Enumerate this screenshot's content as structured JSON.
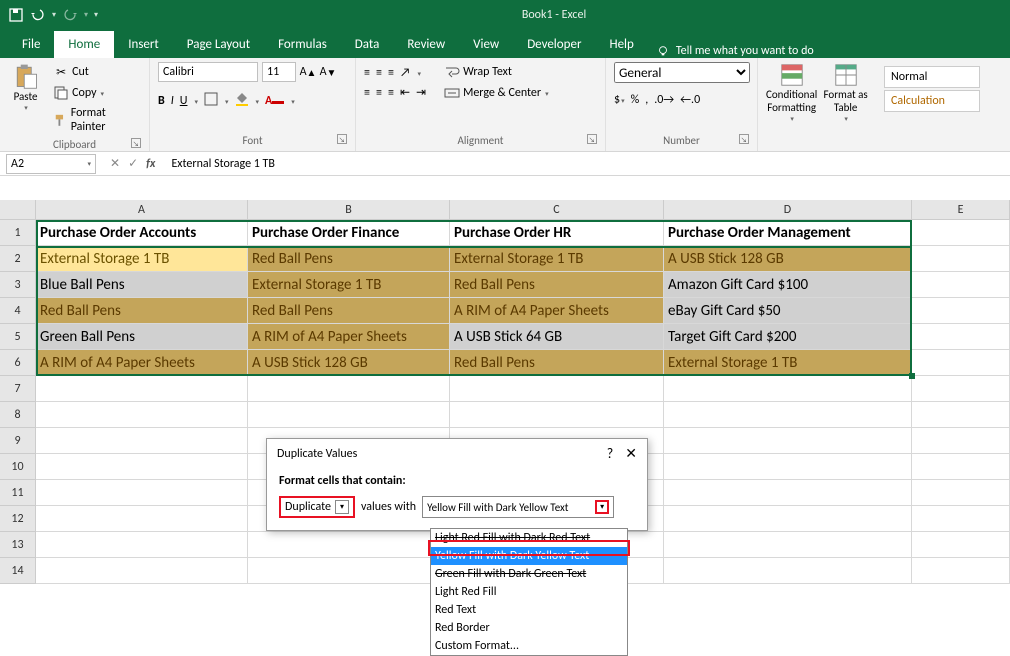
{
  "title": "Book1 - Excel",
  "menus": {
    "file": "File",
    "home": "Home",
    "insert": "Insert",
    "pageLayout": "Page Layout",
    "formulas": "Formulas",
    "data": "Data",
    "review": "Review",
    "view": "View",
    "developer": "Developer",
    "help": "Help",
    "tellMe": "Tell me what you want to do"
  },
  "ribbon": {
    "clipboard": {
      "paste": "Paste",
      "cut": "Cut",
      "copy": "Copy",
      "formatPainter": "Format Painter",
      "label": "Clipboard"
    },
    "font": {
      "name": "Calibri",
      "size": "11",
      "label": "Font"
    },
    "alignment": {
      "wrap": "Wrap Text",
      "merge": "Merge & Center",
      "label": "Alignment"
    },
    "number": {
      "format": "General",
      "label": "Number"
    },
    "styles": {
      "cond": "Conditional Formatting",
      "table": "Format as Table",
      "normal": "Normal",
      "calc": "Calculation"
    }
  },
  "nameBox": "A2",
  "formula": "External Storage 1 TB",
  "cols": [
    "A",
    "B",
    "C",
    "D",
    "E"
  ],
  "headers": {
    "A": "Purchase Order Accounts",
    "B": "Purchase Order Finance",
    "C": "Purchase Order HR",
    "D": "Purchase Order Management"
  },
  "rows": [
    {
      "A": "External Storage 1 TB",
      "B": "Red Ball Pens",
      "C": "External Storage 1 TB",
      "D": "A USB Stick 128 GB"
    },
    {
      "A": "Blue Ball Pens",
      "B": "External Storage 1 TB",
      "C": "Red Ball Pens",
      "D": "Amazon Gift Card $100"
    },
    {
      "A": "Red Ball Pens",
      "B": "Red Ball Pens",
      "C": "A RIM of A4 Paper Sheets",
      "D": "eBay Gift Card $50"
    },
    {
      "A": "Green Ball Pens",
      "B": "A RIM of A4 Paper Sheets",
      "C": "A USB Stick 64 GB",
      "D": "Target Gift Card $200"
    },
    {
      "A": "A RIM of A4 Paper Sheets",
      "B": "A USB Stick 128 GB",
      "C": "Red Ball Pens",
      "D": "External Storage 1 TB"
    }
  ],
  "dupCells": [
    "A2",
    "B2",
    "C2",
    "D2",
    "B3",
    "C3",
    "A4",
    "B4",
    "C4",
    "B5",
    "A6",
    "B6",
    "C6",
    "D6"
  ],
  "nonDupCells": [
    "A3",
    "D3",
    "D4",
    "A5",
    "C5",
    "D5"
  ],
  "dialog": {
    "title": "Duplicate Values",
    "label": "Format cells that contain:",
    "type": "Duplicate",
    "middle": "values with",
    "format": "Yellow Fill with Dark Yellow Text",
    "options": [
      "Light Red Fill with Dark Red Text",
      "Yellow Fill with Dark Yellow Text",
      "Green Fill with Dark Green Text",
      "Light Red Fill",
      "Red Text",
      "Red Border",
      "Custom Format..."
    ]
  }
}
